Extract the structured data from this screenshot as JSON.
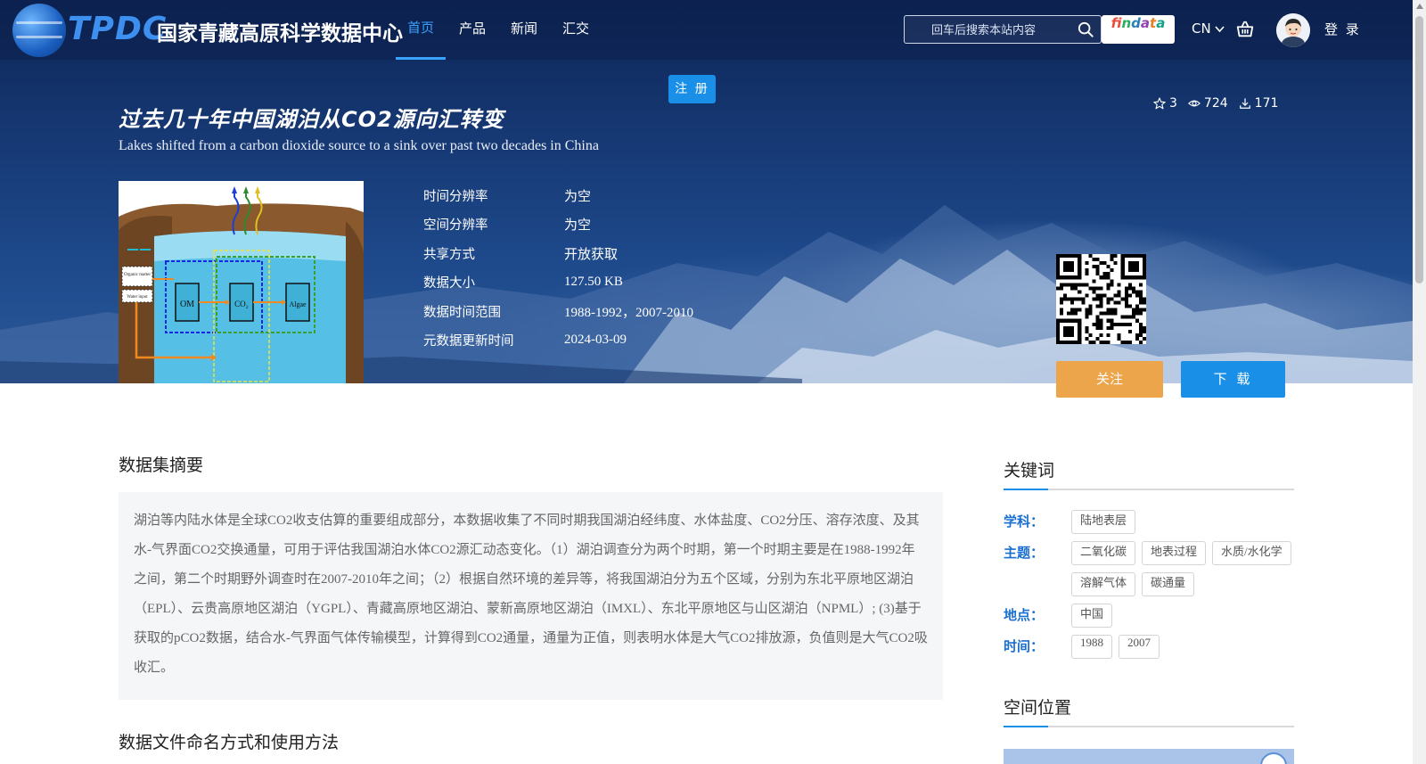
{
  "header": {
    "logo_text": "TPDC",
    "site_name": "国家青藏高原科学数据中心",
    "nav": [
      {
        "label": "首页"
      },
      {
        "label": "产品"
      },
      {
        "label": "新闻"
      },
      {
        "label": "汇交"
      }
    ],
    "search_placeholder": "回车后搜索本站内容",
    "findata_label": "findata",
    "lang": "CN",
    "login": "登 录"
  },
  "register_label": "注 册",
  "dataset": {
    "title_cn": "过去几十年中国湖泊从CO2源向汇转变",
    "title_en": "Lakes shifted from a carbon dioxide source to a sink over past two decades in China",
    "stats": {
      "stars": "3",
      "views": "724",
      "downloads": "171"
    },
    "meta": [
      {
        "label": "时间分辨率",
        "value": "为空"
      },
      {
        "label": "空间分辨率",
        "value": "为空"
      },
      {
        "label": "共享方式",
        "value": "开放获取"
      },
      {
        "label": "数据大小",
        "value": "127.50 KB"
      },
      {
        "label": "数据时间范围",
        "value": "1988-1992，2007-2010"
      },
      {
        "label": "元数据更新时间",
        "value": "2024-03-09"
      }
    ],
    "follow_label": "关注",
    "download_label": "下 载"
  },
  "diagram_labels": {
    "om": "OM",
    "co2": "CO₂",
    "algae": "Algae",
    "left1": "Organic matter",
    "left2": "Water input"
  },
  "abstract": {
    "title": "数据集摘要",
    "text": "湖泊等内陆水体是全球CO2收支估算的重要组成部分，本数据收集了不同时期我国湖泊经纬度、水体盐度、CO2分压、溶存浓度、及其水-气界面CO2交换通量，可用于评估我国湖泊水体CO2源汇动态变化。（1）湖泊调查分为两个时期，第一个时期主要是在1988-1992年之间，第二个时期野外调查时在2007-2010年之间；（2）根据自然环境的差异等，将我国湖泊分为五个区域，分别为东北平原地区湖泊（EPL）、云贵高原地区湖泊（YGPL）、青藏高原地区湖泊、蒙新高原地区湖泊（IMXL）、东北平原地区与山区湖泊（NPML）; (3)基于获取的pCO2数据，结合水-气界面气体传输模型，计算得到CO2通量，通量为正值，则表明水体是大气CO2排放源，负值则是大气CO2吸收汇。"
  },
  "file_naming_title": "数据文件命名方式和使用方法",
  "keywords": {
    "title": "关键词",
    "subject_label": "学科：",
    "subject": [
      "陆地表层"
    ],
    "theme_label": "主题：",
    "theme": [
      "二氧化碳",
      "地表过程",
      "水质/水化学",
      "溶解气体",
      "碳通量"
    ],
    "place_label": "地点：",
    "place": [
      "中国"
    ],
    "time_label": "时间：",
    "time": [
      "1988",
      "2007"
    ]
  },
  "spatial_title": "空间位置",
  "colors": {
    "accent": "#1a8fe8",
    "follow": "#eda54b",
    "keyword_label": "#1a6fd0"
  }
}
